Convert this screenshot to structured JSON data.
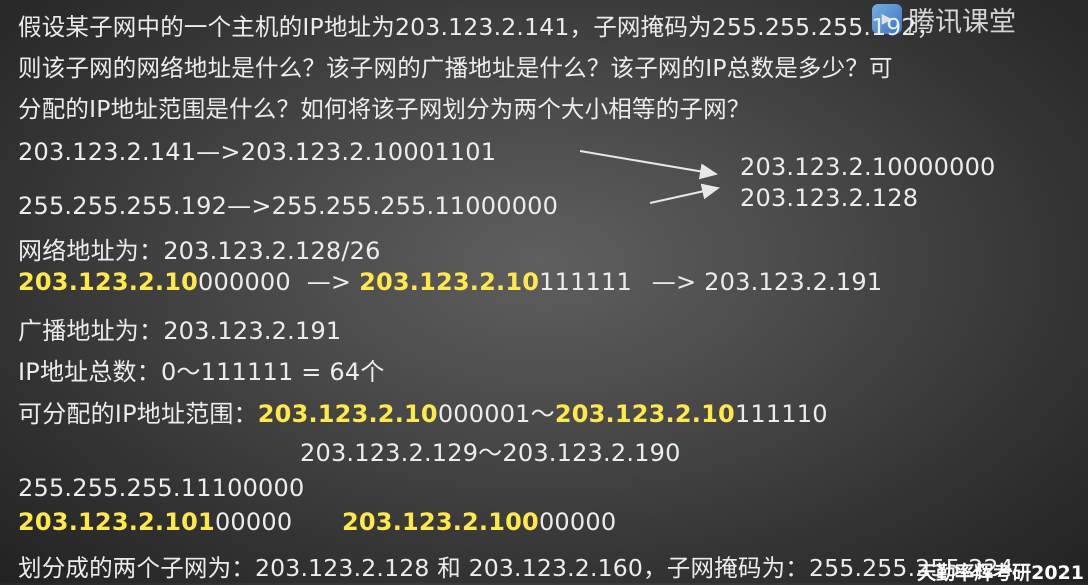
{
  "question": {
    "line1": "假设某子网中的一个主机的IP地址为203.123.2.141，子网掩码为255.255.255.192，",
    "line2": "则该子网的网络地址是什么？该子网的广播地址是什么？该子网的IP总数是多少？可",
    "line3": "分配的IP地址范围是什么？如何将该子网划分为两个大小相等的子网？"
  },
  "work": {
    "ip_binary": "203.123.2.141—>203.123.2.10001101",
    "mask_binary": "255.255.255.192—>255.255.255.11000000",
    "and_result_binary": "203.123.2.10000000",
    "and_result_decimal": "203.123.2.128",
    "network_address": "网络地址为：203.123.2.128/26",
    "bcast_calc": {
      "part1_hl": "203.123.2.10",
      "part1_rest": "000000",
      "arrow1": "—>",
      "part2_hl": "203.123.2.10",
      "part2_rest": "111111",
      "arrow2": "—>",
      "result": "203.123.2.191"
    },
    "broadcast_address": "广播地址为：203.123.2.191",
    "ip_total": "IP地址总数：0～111111 = 64个",
    "assignable": {
      "label": "可分配的IP地址范围：",
      "start_hl": "203.123.2.10",
      "start_rest": "000001",
      "sep": "～",
      "end_hl": "203.123.2.10",
      "end_rest": "111110"
    },
    "assignable_decimal": "203.123.2.129～203.123.2.190",
    "new_mask": "255.255.255.11100000",
    "subnet1_hl": "203.123.2.101",
    "subnet1_rest": "00000",
    "subnet2_hl": "203.123.2.100",
    "subnet2_rest": "00000",
    "conclusion": "划分成的两个子网为：203.123.2.128 和 203.123.2.160，子网掩码为：255.255.255.224"
  },
  "branding": {
    "logo_text": "腾讯课堂",
    "watermark": "天勤率辉考研2021"
  },
  "colors": {
    "highlight": "#ffe84a",
    "text": "#ececec"
  }
}
